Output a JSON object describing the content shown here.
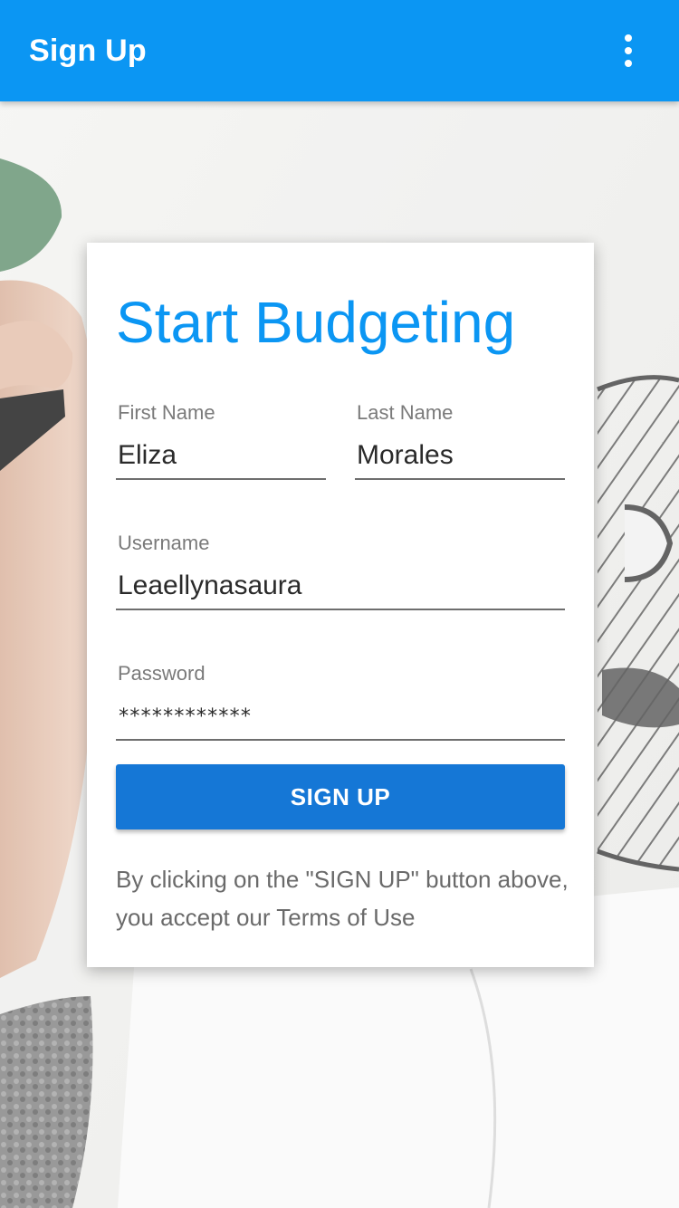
{
  "appbar": {
    "title": "Sign Up",
    "menu_icon": "more-vert-icon"
  },
  "card": {
    "title": "Start Budgeting",
    "fields": {
      "first_name": {
        "label": "First Name",
        "value": "Eliza"
      },
      "last_name": {
        "label": "Last Name",
        "value": "Morales"
      },
      "username": {
        "label": "Username",
        "value": "Leaellynasaura"
      },
      "password": {
        "label": "Password",
        "value": "************"
      }
    },
    "signup_label": "SIGN UP",
    "terms_text": "By clicking on the \"SIGN UP\" button above, you accept our Terms of Use"
  },
  "colors": {
    "primary": "#0b96f3",
    "button": "#1577d6",
    "card": "#ffffff"
  }
}
